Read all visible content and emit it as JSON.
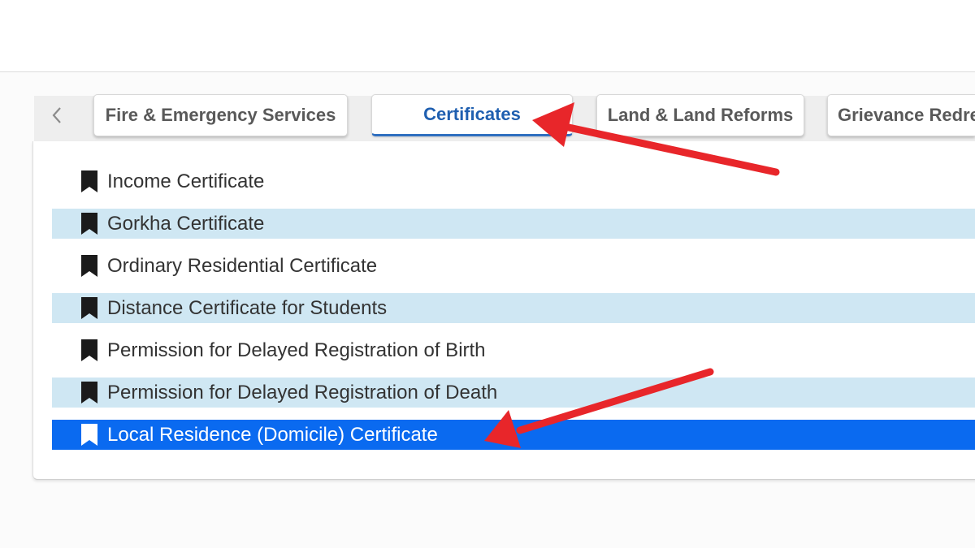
{
  "tabs": {
    "prev_icon": "chevron-left-icon",
    "items": [
      {
        "label": "Fire & Emergency Services",
        "active": false
      },
      {
        "label": "Certificates",
        "active": true
      },
      {
        "label": "Land & Land Reforms",
        "active": false
      },
      {
        "label": "Grievance Redre",
        "active": false
      }
    ]
  },
  "services": {
    "item_icon": "bookmark-icon",
    "items": [
      {
        "label": "Income Certificate"
      },
      {
        "label": "Gorkha Certificate"
      },
      {
        "label": "Ordinary Residential Certificate"
      },
      {
        "label": "Distance Certificate for Students"
      },
      {
        "label": "Permission for Delayed Registration of Birth"
      },
      {
        "label": "Permission for Delayed Registration of Death"
      },
      {
        "label": "Local Residence (Domicile) Certificate",
        "selected": true
      }
    ]
  },
  "colors": {
    "active_tab_text": "#1f5fb0",
    "alternate_row": "#cfe7f3",
    "selected_row": "#0a6af0",
    "annotation_arrow": "#e8262a"
  }
}
